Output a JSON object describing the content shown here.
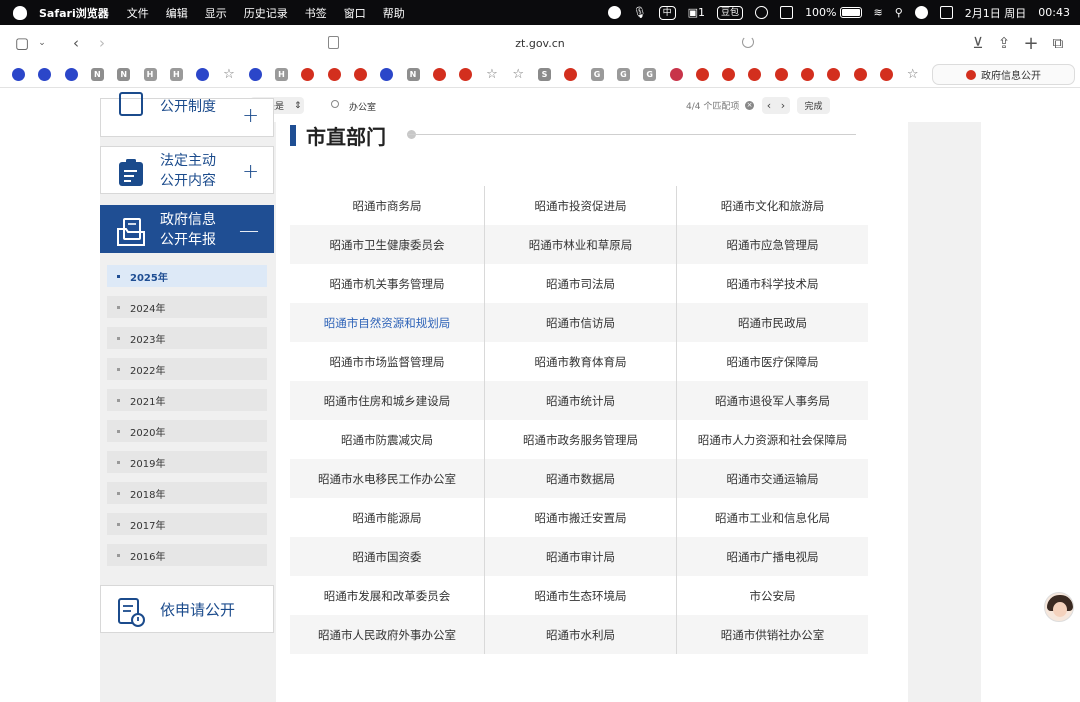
{
  "menubar": {
    "app": "Safari浏览器",
    "items": [
      "文件",
      "编辑",
      "显示",
      "历史记录",
      "书签",
      "窗口",
      "帮助"
    ],
    "status": {
      "doubao": "豆包",
      "wechat_count": "1",
      "battery": "100%",
      "date": "2月1日 周日",
      "time": "00:43",
      "ime": "中"
    }
  },
  "toolbar": {
    "url": "zt.gov.cn"
  },
  "favorites": {
    "icons": [
      "paw-icon",
      "paw-icon",
      "paw-icon",
      "n-icon",
      "n-icon",
      "h-icon",
      "h-icon",
      "paw-icon",
      "star-icon",
      "paw-icon",
      "h-icon",
      "gov-icon",
      "gov-icon",
      "gov-icon",
      "paw-icon",
      "n-icon",
      "gov-icon",
      "gov-icon",
      "star-icon",
      "star-icon",
      "s-icon",
      "gov-icon",
      "g-icon",
      "g-icon",
      "g-icon",
      "ball-icon",
      "gov-icon",
      "gov-icon",
      "gov-icon",
      "gov-icon",
      "gov-icon",
      "gov-icon",
      "gov-icon",
      "gov-icon",
      "star-icon"
    ],
    "tab_label": "政府信息公开"
  },
  "findbar": {
    "scope": "开头是",
    "query": "办公室",
    "count": "4/4 个匹配项",
    "done": "完成"
  },
  "sidebar": {
    "top_partial": "公开制度",
    "boxes": [
      {
        "line1": "法定主动",
        "line2": "公开内容",
        "sign": "+"
      },
      {
        "line1": "政府信息",
        "line2": "公开年报",
        "sign": "—"
      }
    ],
    "years": [
      "2025年",
      "2024年",
      "2023年",
      "2022年",
      "2021年",
      "2020年",
      "2019年",
      "2018年",
      "2017年",
      "2016年"
    ],
    "apply": "依申请公开"
  },
  "main": {
    "title": "市直部门",
    "departments": [
      [
        "昭通市商务局",
        "昭通市投资促进局",
        "昭通市文化和旅游局"
      ],
      [
        "昭通市卫生健康委员会",
        "昭通市林业和草原局",
        "昭通市应急管理局"
      ],
      [
        "昭通市机关事务管理局",
        "昭通市司法局",
        "昭通市科学技术局"
      ],
      [
        "昭通市自然资源和规划局",
        "昭通市信访局",
        "昭通市民政局"
      ],
      [
        "昭通市市场监督管理局",
        "昭通市教育体育局",
        "昭通市医疗保障局"
      ],
      [
        "昭通市住房和城乡建设局",
        "昭通市统计局",
        "昭通市退役军人事务局"
      ],
      [
        "昭通市防震减灾局",
        "昭通市政务服务管理局",
        "昭通市人力资源和社会保障局"
      ],
      [
        "昭通市水电移民工作办公室",
        "昭通市数据局",
        "昭通市交通运输局"
      ],
      [
        "昭通市能源局",
        "昭通市搬迁安置局",
        "昭通市工业和信息化局"
      ],
      [
        "昭通市国资委",
        "昭通市审计局",
        "昭通市广播电视局"
      ],
      [
        "昭通市发展和改革委员会",
        "昭通市生态环境局",
        "市公安局"
      ],
      [
        "昭通市人民政府外事办公室",
        "昭通市水利局",
        "昭通市供销社办公室"
      ]
    ]
  }
}
